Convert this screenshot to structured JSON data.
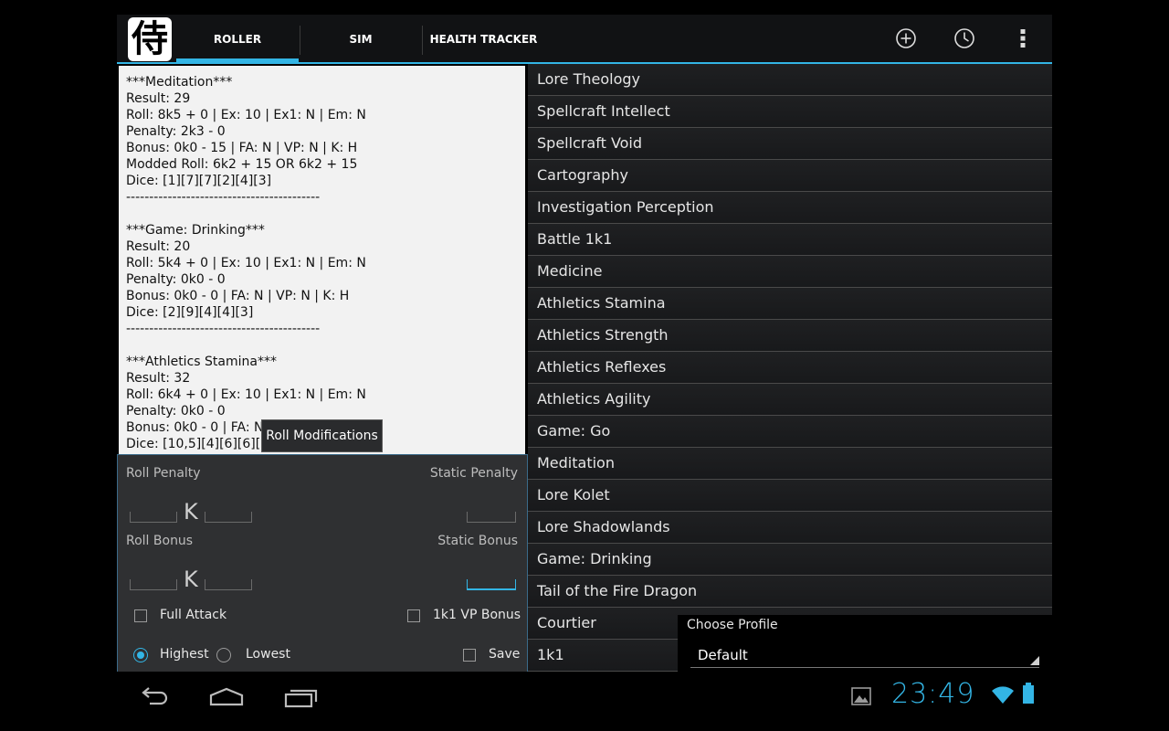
{
  "actionbar": {
    "app_glyph": "侍",
    "tabs": [
      {
        "label": "ROLLER",
        "active": true
      },
      {
        "label": "SIM",
        "active": false
      },
      {
        "label": "HEALTH TRACKER",
        "active": false
      }
    ],
    "icons": [
      "add-icon",
      "history-icon",
      "overflow-menu-icon"
    ],
    "accent_color": "#33b5e5"
  },
  "log": {
    "entries": [
      {
        "lines": [
          "***Meditation***",
          "Result: 29",
          "Roll: 8k5 + 0 | Ex: 10 | Ex1: N | Em: N",
          "Penalty: 2k3 - 0",
          "Bonus: 0k0 - 15 | FA: N | VP: N | K: H",
          "Modded Roll: 6k2 + 15 OR 6k2 + 15",
          "Dice: [1][7][7][2][4][3]",
          "------------------------------------------"
        ]
      },
      {
        "lines": [
          "***Game: Drinking***",
          "Result: 20",
          "Roll: 5k4 + 0 | Ex: 10 | Ex1: N | Em: N",
          "Penalty: 0k0 - 0",
          "Bonus: 0k0 - 0 | FA: N | VP: N | K: H",
          "Dice: [2][9][4][4][3]",
          "------------------------------------------"
        ]
      },
      {
        "lines": [
          "***Athletics Stamina***",
          "Result: 32",
          "Roll: 6k4 + 0 | Ex: 10 | Ex1: N | Em: N",
          "Penalty: 0k0 - 0",
          "Bonus: 0k0 - 0 | FA: N",
          "Dice: [10,5][4][6][6][2][5"
        ]
      }
    ]
  },
  "tooltip": {
    "text": "Roll Modifications"
  },
  "mods": {
    "roll_penalty_label": "Roll Penalty",
    "static_penalty_label": "Static Penalty",
    "roll_bonus_label": "Roll Bonus",
    "static_bonus_label": "Static Bonus",
    "k_char": "K",
    "full_attack_label": "Full Attack",
    "vp_bonus_label": "1k1 VP Bonus",
    "highest_label": "Highest",
    "lowest_label": "Lowest",
    "save_label": "Save",
    "selected_keep": "Highest"
  },
  "skills": [
    "Lore Theology",
    "Spellcraft Intellect",
    "Spellcraft Void",
    "Cartography",
    "Investigation Perception",
    "Battle 1k1",
    "Medicine",
    "Athletics Stamina",
    "Athletics Strength",
    "Athletics Reflexes",
    "Athletics Agility",
    "Game: Go",
    "Meditation",
    "Lore Kolet",
    "Lore Shadowlands",
    "Game: Drinking",
    "Tail of the Fire Dragon",
    "Courtier",
    "1k1"
  ],
  "profile": {
    "label": "Choose Profile",
    "value": "Default"
  },
  "system": {
    "clock": "23:49",
    "nav_icons": [
      "back-icon",
      "home-icon",
      "recents-icon"
    ],
    "status_icons": [
      "gallery-icon",
      "wifi-icon",
      "battery-icon"
    ]
  }
}
